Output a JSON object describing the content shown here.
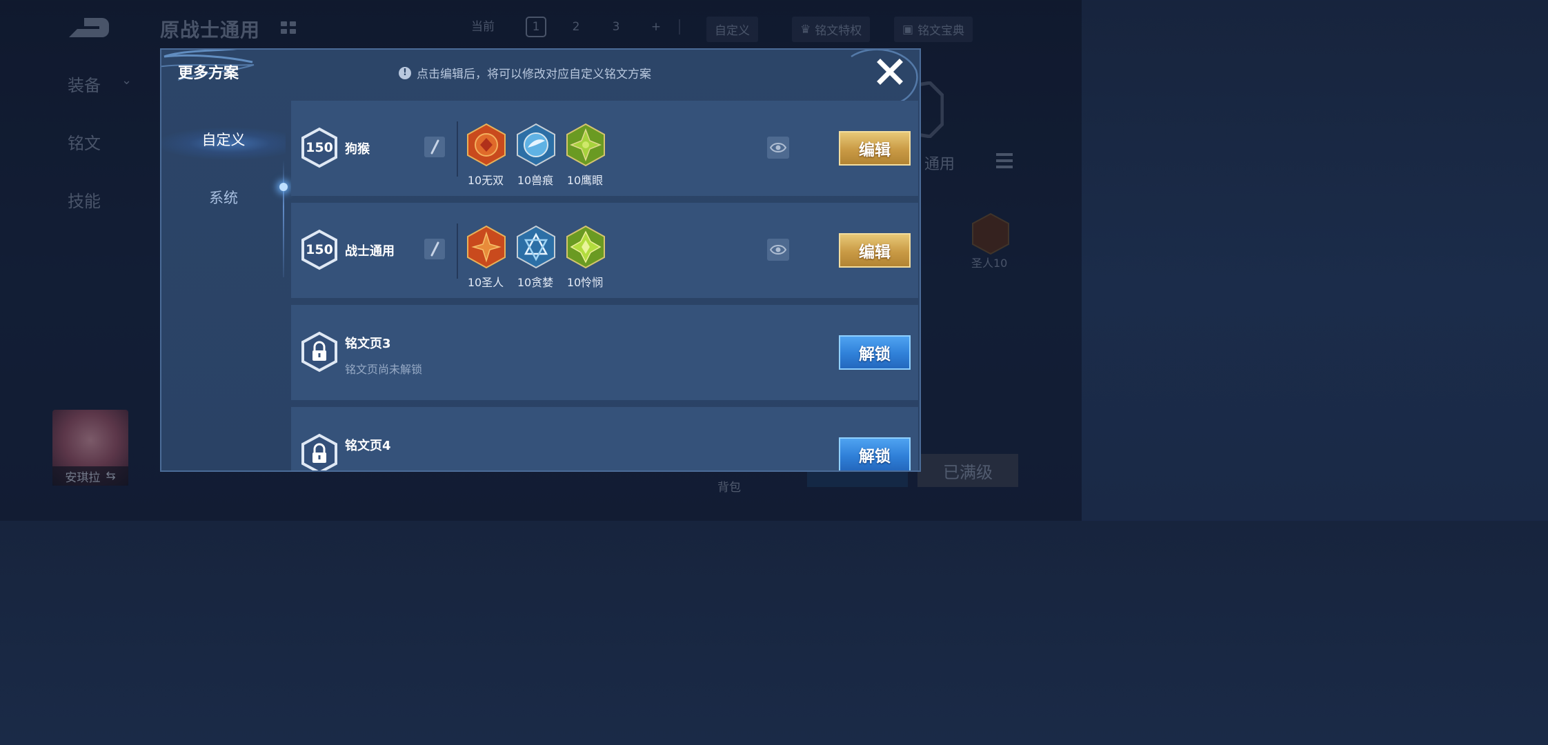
{
  "background": {
    "title": "原战士通用",
    "page_label": "当前",
    "pages": [
      "1",
      "2",
      "3",
      "+"
    ],
    "custom_label": "自定义",
    "privilege_label": "铭文特权",
    "guide_label": "铭文宝典",
    "side_tabs": [
      "装备",
      "铭文",
      "技能"
    ],
    "right_title": "通用",
    "right_rune_label": "圣人10",
    "hero_name": "安琪拉",
    "bag_label": "背包",
    "max_level_label": "已满级"
  },
  "modal": {
    "title": "更多方案",
    "hint": "点击编辑后，将可以修改对应自定义铭文方案",
    "tabs": {
      "custom": "自定义",
      "system": "系统"
    },
    "plans": [
      {
        "level": "150",
        "name": "狗猴",
        "runes": [
          "10无双",
          "10兽痕",
          "10鹰眼"
        ],
        "rune_colors": [
          "#d8551f",
          "#3d9ad6",
          "#8fbf2f"
        ],
        "button": "编辑"
      },
      {
        "level": "150",
        "name": "战士通用",
        "runes": [
          "10圣人",
          "10贪婪",
          "10怜悯"
        ],
        "rune_colors": [
          "#d8551f",
          "#3d9ad6",
          "#8fbf2f"
        ],
        "button": "编辑"
      }
    ],
    "locked": [
      {
        "name": "铭文页3",
        "sub": "铭文页尚未解锁",
        "button": "解锁"
      },
      {
        "name": "铭文页4",
        "button": "解锁"
      }
    ]
  },
  "icons": {
    "back": "back-arrow-icon",
    "close": "close-icon",
    "info": "info-icon",
    "rename": "pencil-icon",
    "preview": "eye-icon",
    "lock": "lock-icon"
  }
}
